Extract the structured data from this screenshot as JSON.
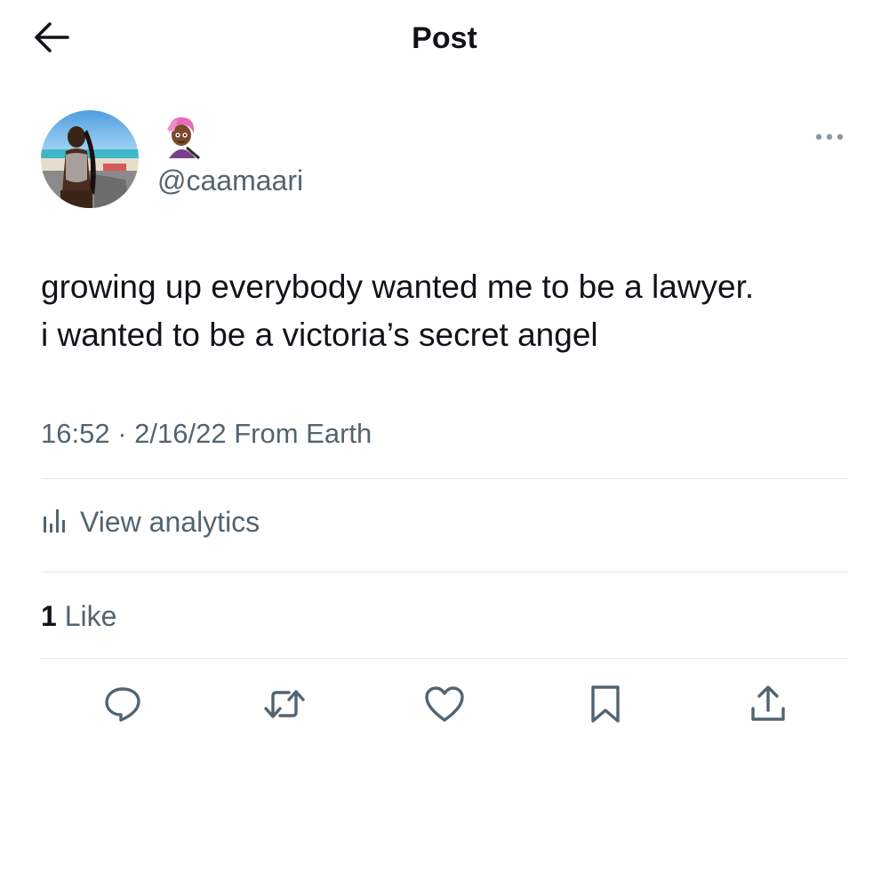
{
  "header": {
    "title": "Post",
    "back_icon": "arrow-left-icon"
  },
  "author": {
    "avatar": "avatar-photo",
    "name_emoji": "🧟🏾‍♀️",
    "handle": "@caamaari",
    "more_icon": "more-horizontal-icon"
  },
  "post": {
    "lines": [
      "growing up everybody wanted me to be a lawyer.",
      "i wanted to be a victoria’s secret angel"
    ],
    "time": "16:52",
    "separator": "·",
    "date": "2/16/22",
    "source": "From Earth"
  },
  "analytics": {
    "icon": "bar-chart-icon",
    "label": "View analytics"
  },
  "stats": {
    "likes_count": "1",
    "likes_label": "Like"
  },
  "actions": [
    {
      "name": "reply",
      "icon": "reply-icon"
    },
    {
      "name": "repost",
      "icon": "repost-icon"
    },
    {
      "name": "like",
      "icon": "heart-icon"
    },
    {
      "name": "bookmark",
      "icon": "bookmark-icon"
    },
    {
      "name": "share",
      "icon": "share-icon"
    }
  ],
  "colors": {
    "text_primary": "#0f1419",
    "text_secondary": "#536471",
    "divider": "#e1e6ea",
    "background": "#ffffff"
  }
}
